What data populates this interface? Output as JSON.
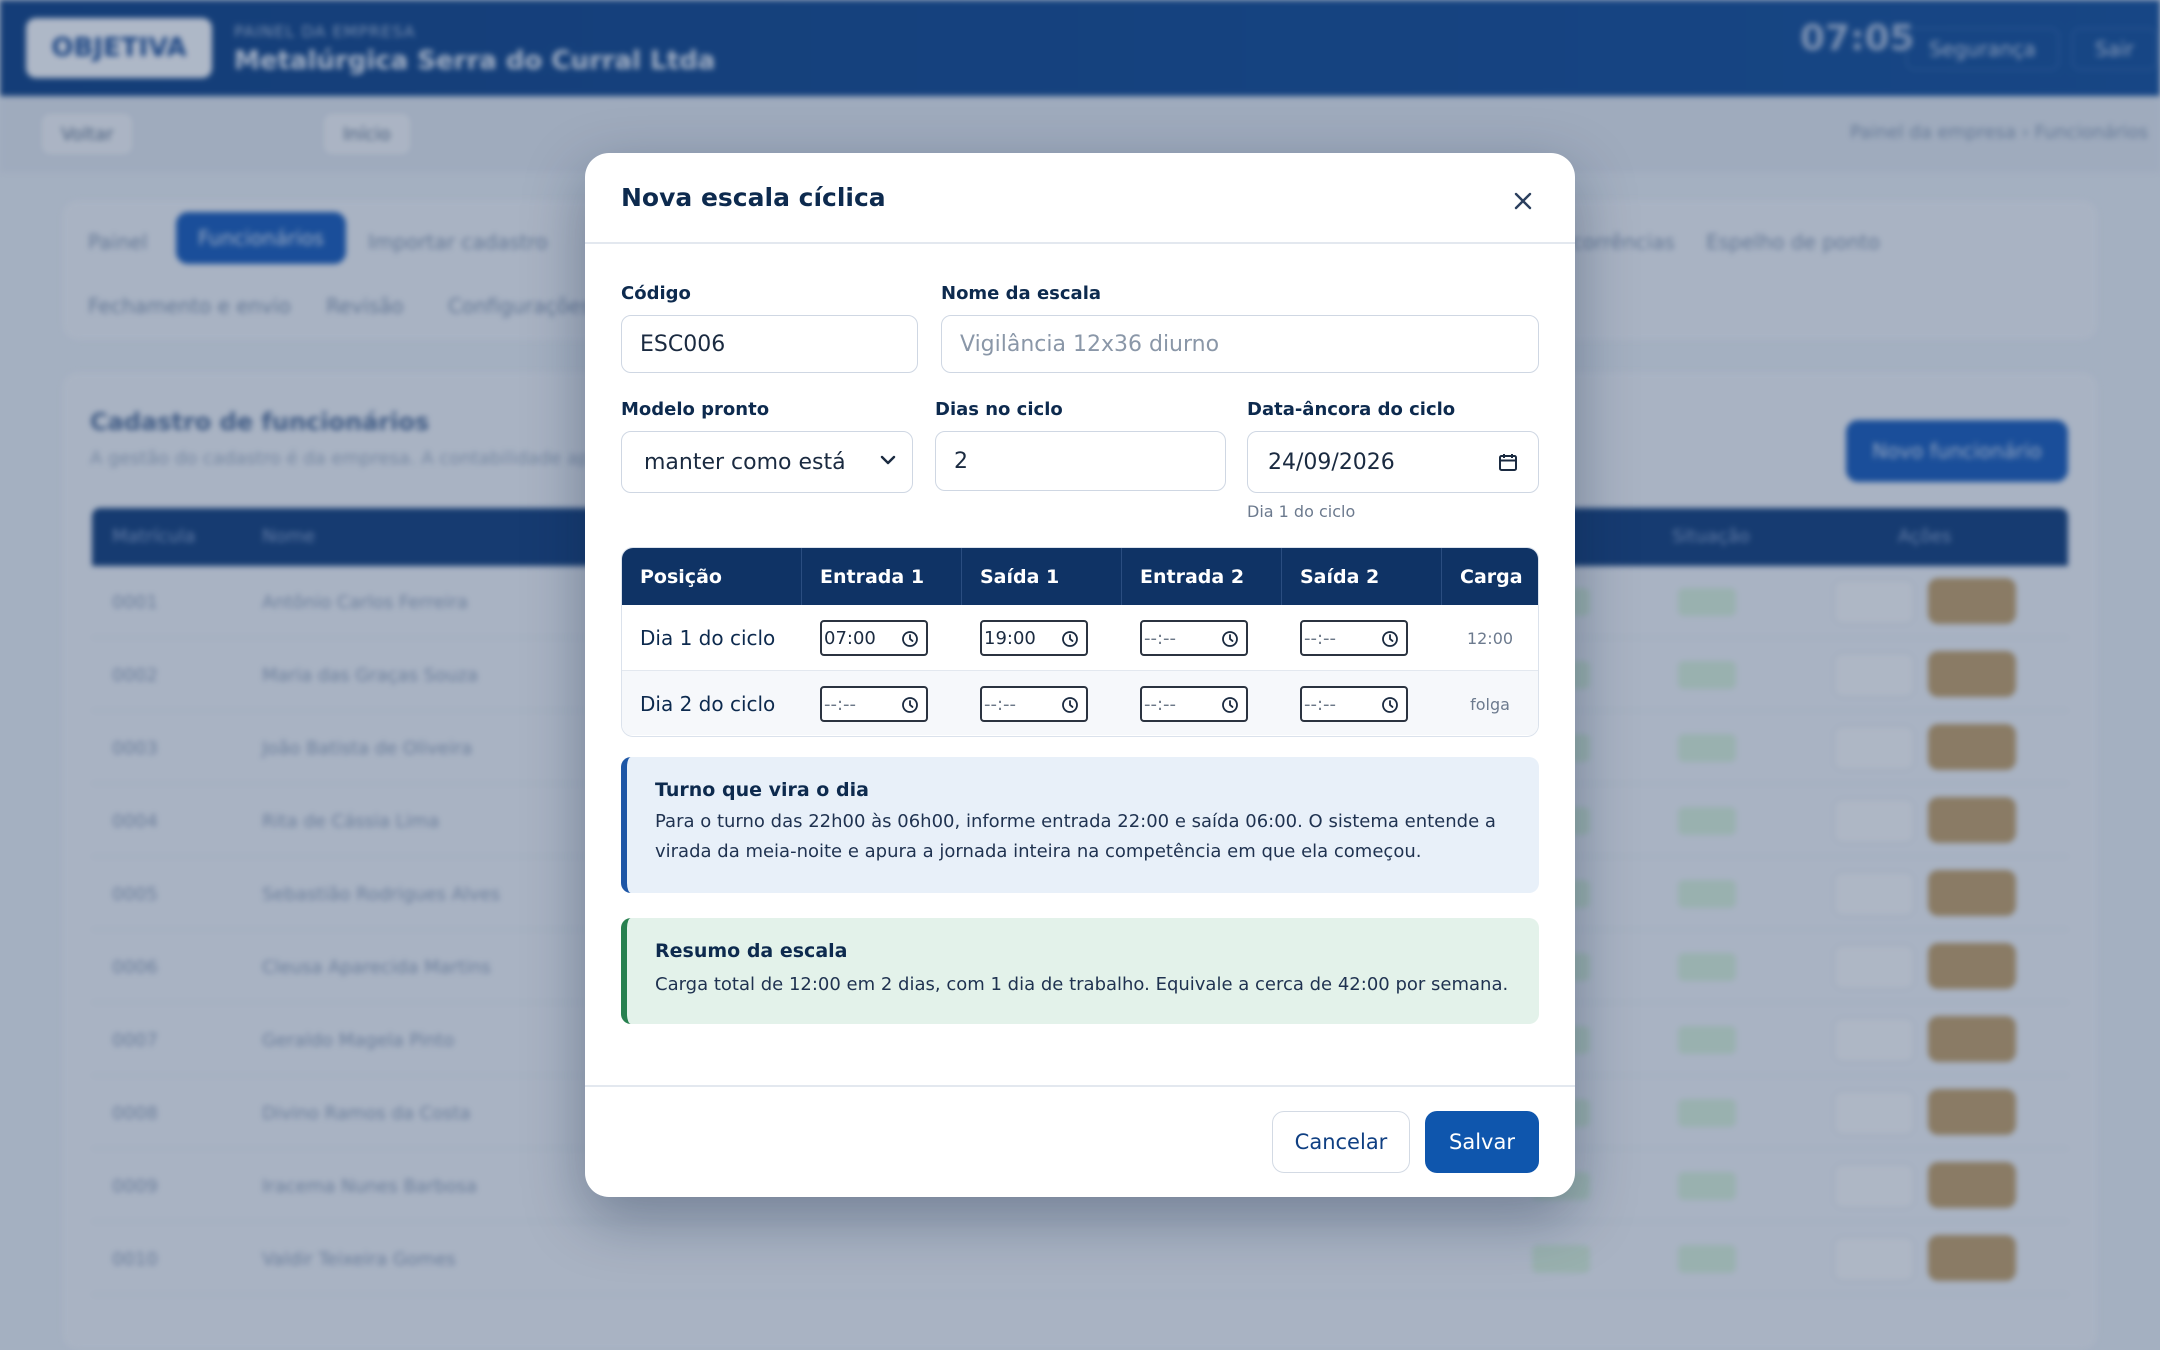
{
  "background": {
    "logo_text": "OBJETIVA",
    "company_label": "PAINEL DA EMPRESA",
    "company_name": "Metalúrgica Serra do Curral Ltda",
    "clock": "07:05",
    "security_label": "Segurança",
    "exit_label": "Sair",
    "back_label": "Voltar",
    "home_label": "Início",
    "breadcrumb": "Painel da empresa › Funcionários",
    "tabs": [
      "Painel",
      "Funcionários",
      "Importar cadastro",
      "Ocorrências",
      "Espelho de ponto",
      "Fechamento e envio",
      "Revisão",
      "Configurações"
    ],
    "list_title": "Cadastro de funcionários",
    "list_subtitle": "A gestão do cadastro é da empresa. A contabilidade apura...",
    "new_button": "Novo funcionário",
    "columns": [
      "Matrícula",
      "Nome",
      "Situação",
      "Ações"
    ],
    "rows": [
      {
        "id": "0001",
        "name": "Antônio Carlos Ferreira"
      },
      {
        "id": "0002",
        "name": "Maria das Graças Souza"
      },
      {
        "id": "0003",
        "name": "João Batista de Oliveira"
      },
      {
        "id": "0004",
        "name": "Rita de Cássia Lima"
      },
      {
        "id": "0005",
        "name": "Sebastião Rodrigues Alves"
      },
      {
        "id": "0006",
        "name": "Cleusa Aparecida Martins"
      },
      {
        "id": "0007",
        "name": "Geraldo Magela Pinto"
      },
      {
        "id": "0008",
        "name": "Divino Ramos da Costa"
      },
      {
        "id": "0009",
        "name": "Iracema Nunes Barbosa"
      },
      {
        "id": "0010",
        "name": "Valdir Teixeira Gomes"
      }
    ]
  },
  "modal": {
    "title": "Nova escala cíclica",
    "fields": {
      "code_label": "Código",
      "code_value": "ESC006",
      "name_label": "Nome da escala",
      "name_placeholder": "Vigilância 12x36 diurno",
      "model_label": "Modelo pronto",
      "model_value": "manter como está",
      "days_label": "Dias no ciclo",
      "days_value": "2",
      "anchor_label": "Data-âncora do ciclo",
      "anchor_value": "24/09/2026",
      "anchor_hint": "Dia 1 do ciclo"
    },
    "table": {
      "headers": [
        "Posição",
        "Entrada 1",
        "Saída 1",
        "Entrada 2",
        "Saída 2",
        "Carga"
      ],
      "rows": [
        {
          "position": "Dia 1 do ciclo",
          "in1": "07:00",
          "out1": "19:00",
          "in2": "--:--",
          "out2": "--:--",
          "load": "12:00"
        },
        {
          "position": "Dia 2 do ciclo",
          "in1": "--:--",
          "out1": "--:--",
          "in2": "--:--",
          "out2": "--:--",
          "load": "folga"
        }
      ]
    },
    "info_turn": {
      "title": "Turno que vira o dia",
      "line1": "Para o turno das 22h00 às 06h00, informe entrada 22:00 e saída 06:00. O sistema entende a",
      "line2": "virada da meia-noite e apura a jornada inteira na competência em que ela começou."
    },
    "info_summary": {
      "title": "Resumo da escala",
      "text": "Carga total de 12:00 em 2 dias, com 1 dia de trabalho. Equivale a cerca de 42:00 por semana."
    },
    "cancel_label": "Cancelar",
    "save_label": "Salvar"
  },
  "colors": {
    "primary": "#0f56ad",
    "header_dark": "#0f3365",
    "info_blue_border": "#1d56a6",
    "info_green_border": "#27804f"
  }
}
